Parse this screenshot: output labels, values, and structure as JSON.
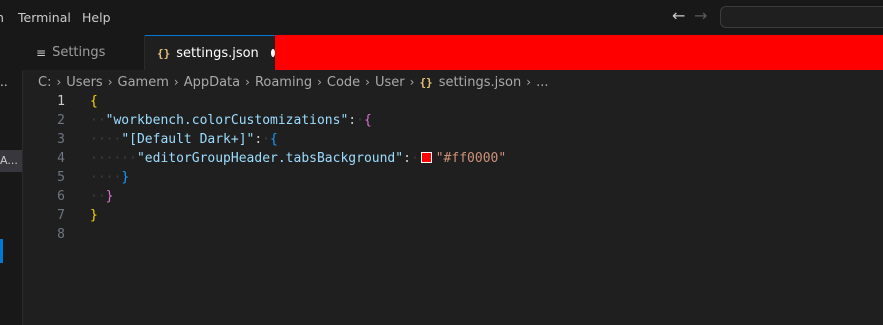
{
  "menu": [
    "n",
    "Terminal",
    "Help"
  ],
  "nav": {
    "back_icon": "arrow-left-icon",
    "forward_icon": "arrow-right-icon"
  },
  "sidebar": {
    "dots": "..",
    "item_label": "A..."
  },
  "tabs": [
    {
      "label": "Settings",
      "icon": "settings-file-icon",
      "active": false
    },
    {
      "label": "settings.json",
      "icon": "{}",
      "active": true,
      "dirty": true
    }
  ],
  "breadcrumbs": [
    "C:",
    "Users",
    "Gamem",
    "AppData",
    "Roaming",
    "Code",
    "User",
    "settings.json",
    "..."
  ],
  "breadcrumb_json_icon": "{}",
  "editor": {
    "lines": [
      {
        "num": "1",
        "code": "{"
      },
      {
        "num": "2",
        "key": "\"workbench.colorCustomizations\"",
        "colon": ":",
        "brace": "{"
      },
      {
        "num": "3",
        "key": "\"[Default Dark+]\"",
        "colon": ":",
        "brace": "{"
      },
      {
        "num": "4",
        "key": "\"editorGroupHeader.tabsBackground\"",
        "colon": ":",
        "value": "\"#ff0000\""
      },
      {
        "num": "5",
        "brace": "}"
      },
      {
        "num": "6",
        "brace": "}"
      },
      {
        "num": "7",
        "brace": "}"
      },
      {
        "num": "8"
      }
    ]
  },
  "colors": {
    "tab_bar_background": "#ff0000",
    "editor_background": "#1f1f1f",
    "accent": "#0078d4",
    "swatch": "#ff0000"
  }
}
